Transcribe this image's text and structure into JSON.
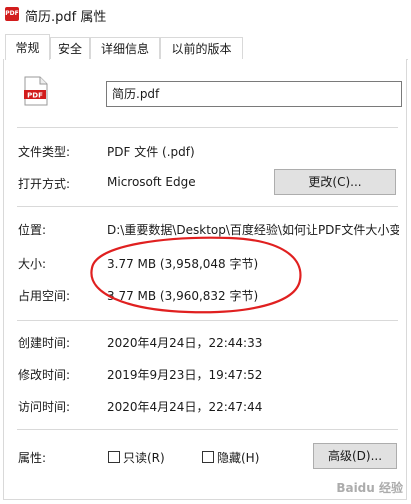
{
  "window": {
    "title": "简历.pdf 属性",
    "icon": "pdf-file-icon"
  },
  "tabs": [
    {
      "label": "常规",
      "active": true
    },
    {
      "label": "安全",
      "active": false
    },
    {
      "label": "详细信息",
      "active": false
    },
    {
      "label": "以前的版本",
      "active": false
    }
  ],
  "general": {
    "file_icon_text": "PDF",
    "file_name": "简历.pdf",
    "file_type_label": "文件类型:",
    "file_type_value": "PDF 文件 (.pdf)",
    "opens_with_label": "打开方式:",
    "opens_with_value": "Microsoft Edge",
    "change_button": "更改(C)...",
    "location_label": "位置:",
    "location_value": "D:\\重要数据\\Desktop\\百度经验\\如何让PDF文件大小变",
    "size_label": "大小:",
    "size_value": "3.77 MB (3,958,048 字节)",
    "size_on_disk_label": "占用空间:",
    "size_on_disk_value": "3.77 MB (3,960,832 字节)",
    "created_label": "创建时间:",
    "created_value": "2020年4月24日，22:44:33",
    "modified_label": "修改时间:",
    "modified_value": "2019年9月23日，19:47:52",
    "accessed_label": "访问时间:",
    "accessed_value": "2020年4月24日，22:47:44",
    "attributes_label": "属性:",
    "readonly_label": "只读(R)",
    "readonly_checked": false,
    "hidden_label": "隐藏(H)",
    "hidden_checked": false,
    "advanced_button": "高级(D)..."
  },
  "watermark": "Baidu 经验",
  "colors": {
    "annotation_red": "#e02020",
    "pdf_red": "#d21c1c",
    "button_bg": "#e1e1e1"
  }
}
